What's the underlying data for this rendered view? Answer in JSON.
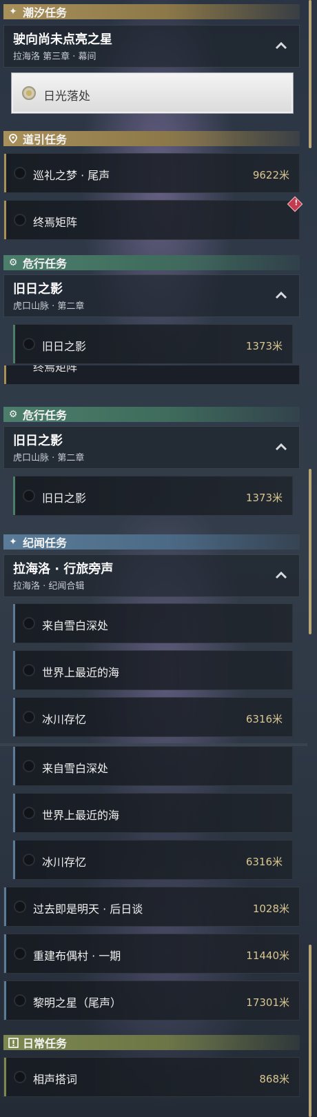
{
  "sections": {
    "tide": "潮汐任务",
    "guide": "道引任务",
    "danger1": "危行任务",
    "danger2": "危行任务",
    "chronicle": "纪闻任务",
    "daily": "日常任务"
  },
  "tide_quest": {
    "title": "驶向尚未点亮之星",
    "subtitle": "拉海洛 第三章 · 幕间",
    "item": "日光落处"
  },
  "guide_items": [
    {
      "name": "巡礼之梦 · 尾声",
      "dist": "9622米"
    },
    {
      "name": "终焉矩阵",
      "dist": ""
    }
  ],
  "danger_quest": {
    "title": "旧日之影",
    "subtitle": "虎口山脉 · 第二章",
    "item": "旧日之影",
    "dist": "1373米"
  },
  "overlap_text": "终焉矩阵",
  "chronicle_quest": {
    "title": "拉海洛 · 行旅旁声",
    "subtitle": "拉海洛 · 纪闻合辑"
  },
  "chronicle_items": [
    {
      "name": "来自雪白深处",
      "dist": ""
    },
    {
      "name": "世界上最近的海",
      "dist": ""
    },
    {
      "name": "冰川存忆",
      "dist": "6316米"
    }
  ],
  "chronicle_items_dup": [
    {
      "name": "来自雪白深处",
      "dist": ""
    },
    {
      "name": "世界上最近的海",
      "dist": ""
    },
    {
      "name": "冰川存忆",
      "dist": "6316米"
    }
  ],
  "other_items": [
    {
      "name": "过去即是明天 · 后日谈",
      "dist": "1028米"
    },
    {
      "name": "重建布偶村 · 一期",
      "dist": "11440米"
    },
    {
      "name": "黎明之星（尾声）",
      "dist": "17301米"
    }
  ],
  "daily_items": [
    {
      "name": "相声搭词",
      "dist": "868米"
    }
  ],
  "badge": "!",
  "colors": {
    "gold": "#a8905a",
    "green": "#4c7e6c",
    "blue": "#5a7c98",
    "olive": "#7c8850",
    "distance": "#d9c792"
  }
}
